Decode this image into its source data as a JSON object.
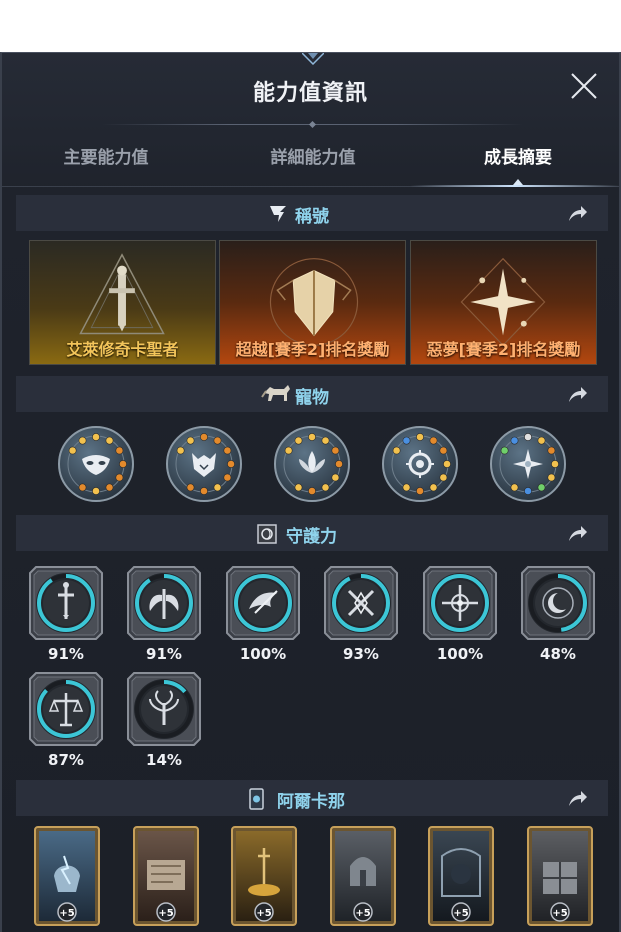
{
  "header": {
    "title": "能力值資訊"
  },
  "tabs": [
    {
      "label": "主要能力值",
      "active": false
    },
    {
      "label": "詳細能力值",
      "active": false
    },
    {
      "label": "成長摘要",
      "active": true
    }
  ],
  "sections": {
    "titles": {
      "label": "稱號",
      "icon": "title-badge-icon"
    },
    "pets": {
      "label": "寵物",
      "icon": "horse-icon"
    },
    "guardians": {
      "label": "守護力",
      "icon": "guardian-icon"
    },
    "arcana": {
      "label": "阿爾卡那",
      "icon": "arcana-card-icon"
    }
  },
  "title_cards": [
    {
      "name": "艾萊修奇卡聖者",
      "style": "gold"
    },
    {
      "name": "超越[賽季2]排名獎勵",
      "style": "orange"
    },
    {
      "name": "惡夢[賽季2]排名獎勵",
      "style": "orange"
    }
  ],
  "pets": [
    {
      "icon": "mask-emblem-icon"
    },
    {
      "icon": "wolf-emblem-icon"
    },
    {
      "icon": "lotus-emblem-icon"
    },
    {
      "icon": "eye-emblem-icon"
    },
    {
      "icon": "star-emblem-icon"
    }
  ],
  "guardians": [
    {
      "icon": "sword-emblem-icon",
      "percent": "91%",
      "fill": 0.91
    },
    {
      "icon": "wings-emblem-icon",
      "percent": "91%",
      "fill": 0.91
    },
    {
      "icon": "phoenix-emblem-icon",
      "percent": "100%",
      "fill": 1.0
    },
    {
      "icon": "cross-swords-emblem-icon",
      "percent": "93%",
      "fill": 0.93
    },
    {
      "icon": "compass-emblem-icon",
      "percent": "100%",
      "fill": 1.0
    },
    {
      "icon": "moon-emblem-icon",
      "percent": "48%",
      "fill": 0.48
    },
    {
      "icon": "scales-emblem-icon",
      "percent": "87%",
      "fill": 0.87
    },
    {
      "icon": "tree-emblem-icon",
      "percent": "14%",
      "fill": 0.14
    }
  ],
  "arcana_cards": [
    {
      "icon": "lightning-vessel-icon",
      "badge": "+5"
    },
    {
      "icon": "scroll-altar-icon",
      "badge": "+5"
    },
    {
      "icon": "treasure-sword-icon",
      "badge": "+5"
    },
    {
      "icon": "bell-tower-icon",
      "badge": "+5"
    },
    {
      "icon": "mirror-frame-icon",
      "badge": "+5"
    },
    {
      "icon": "gate-scales-icon",
      "badge": "+5"
    }
  ],
  "colors": {
    "panel_bg": "#1f232c",
    "section_bg": "#2a2f3b",
    "section_label": "#8fd3ec",
    "guardian_ring": "#3cc6d6",
    "gold_text": "#f3c55a",
    "orange_text": "#ffb070"
  }
}
